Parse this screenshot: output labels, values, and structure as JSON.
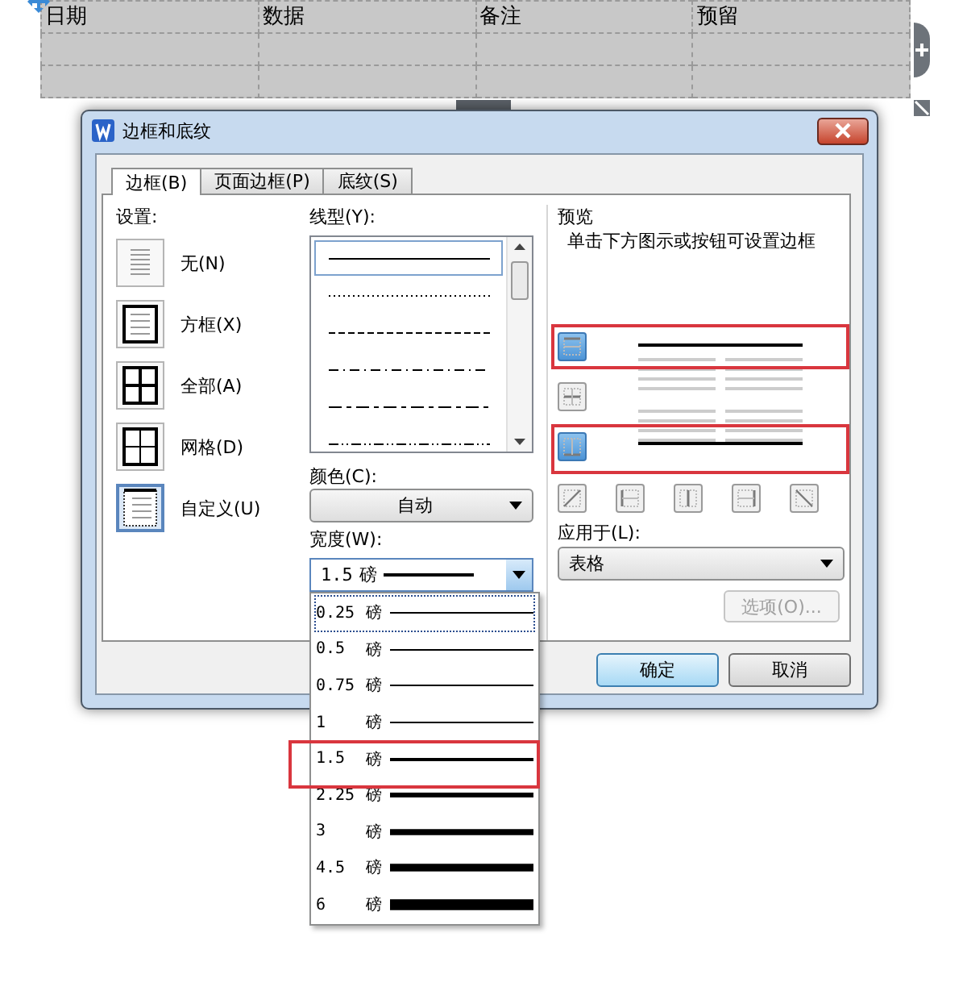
{
  "table": {
    "columns": [
      "日期",
      "数据",
      "备注",
      "预留"
    ]
  },
  "dialog": {
    "title": "边框和底纹",
    "tabs": [
      {
        "label": "边框(B)",
        "selected": true
      },
      {
        "label": "页面边框(P)",
        "selected": false
      },
      {
        "label": "底纹(S)",
        "selected": false
      }
    ],
    "settings": {
      "label": "设置:",
      "items": [
        {
          "kind": "none",
          "label": "无(N)",
          "selected": false
        },
        {
          "kind": "box",
          "label": "方框(X)",
          "selected": false
        },
        {
          "kind": "all",
          "label": "全部(A)",
          "selected": false
        },
        {
          "kind": "grid",
          "label": "网格(D)",
          "selected": false
        },
        {
          "kind": "custom",
          "label": "自定义(U)",
          "selected": true
        }
      ]
    },
    "line_style": {
      "label": "线型(Y):",
      "items": [
        {
          "kind": "solid",
          "selected": true
        },
        {
          "kind": "dotted",
          "selected": false
        },
        {
          "kind": "dashed",
          "selected": false
        },
        {
          "kind": "dash-dot",
          "selected": false
        },
        {
          "kind": "long-dash-dot",
          "selected": false
        },
        {
          "kind": "dash-dot-dot",
          "selected": false
        }
      ]
    },
    "color": {
      "label": "颜色(C):",
      "value": "自动"
    },
    "width": {
      "label": "宽度(W):",
      "value": "1.5",
      "unit": "磅",
      "expanded": true,
      "options": [
        {
          "value": "0.25",
          "unit": "磅",
          "focused": true,
          "highlighted": false
        },
        {
          "value": "0.5",
          "unit": "磅",
          "focused": false,
          "highlighted": false
        },
        {
          "value": "0.75",
          "unit": "磅",
          "focused": false,
          "highlighted": false
        },
        {
          "value": "1",
          "unit": "磅",
          "focused": false,
          "highlighted": false
        },
        {
          "value": "1.5",
          "unit": "磅",
          "focused": false,
          "highlighted": true
        },
        {
          "value": "2.25",
          "unit": "磅",
          "focused": false,
          "highlighted": false
        },
        {
          "value": "3",
          "unit": "磅",
          "focused": false,
          "highlighted": false
        },
        {
          "value": "4.5",
          "unit": "磅",
          "focused": false,
          "highlighted": false
        },
        {
          "value": "6",
          "unit": "磅",
          "focused": false,
          "highlighted": false
        }
      ]
    },
    "preview": {
      "label": "预览",
      "hint": "单击下方图示或按钮可设置边框",
      "side_buttons": [
        {
          "kind": "top",
          "pressed": true,
          "highlighted": true
        },
        {
          "kind": "inside-horizontal",
          "pressed": false,
          "highlighted": false
        },
        {
          "kind": "bottom",
          "pressed": true,
          "highlighted": true
        }
      ],
      "bottom_buttons": [
        {
          "kind": "diagonal-up"
        },
        {
          "kind": "left"
        },
        {
          "kind": "inside-vertical"
        },
        {
          "kind": "right"
        },
        {
          "kind": "diagonal-down"
        }
      ]
    },
    "apply_to": {
      "label": "应用于(L):",
      "value": "表格"
    },
    "options_button": {
      "label": "选项(O)...",
      "disabled": true
    },
    "buttons": [
      {
        "label": "确定",
        "default": true
      },
      {
        "label": "取消",
        "default": false
      }
    ]
  }
}
